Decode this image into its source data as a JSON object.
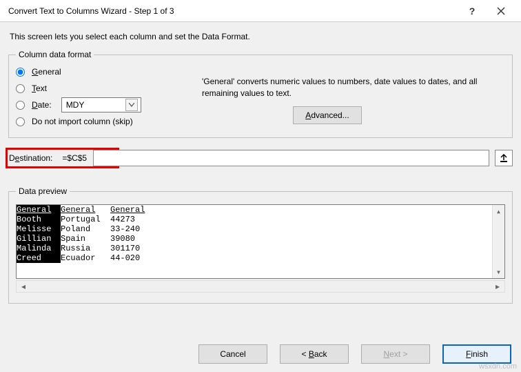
{
  "title": "Convert Text to Columns Wizard - Step 1 of 3",
  "description": "This screen lets you select each column and set the Data Format.",
  "fmt": {
    "legend": "Column data format",
    "general": "General",
    "text": "Text",
    "date": "Date:",
    "skip": "Do not import column (skip)",
    "date_option": "MDY",
    "selected": "general",
    "hint": "'General' converts numeric values to numbers, date values to dates, and all remaining values to text.",
    "advanced": "Advanced..."
  },
  "destination": {
    "label": "Destination:",
    "value": "=$C$5"
  },
  "preview": {
    "legend": "Data preview",
    "headers": [
      "General",
      "General",
      "General"
    ],
    "rows": [
      [
        "Booth",
        "Portugal",
        "44273"
      ],
      [
        "Melisse",
        "Poland",
        "33-240"
      ],
      [
        "Gillian",
        "Spain",
        "39080"
      ],
      [
        "Malinda",
        "Russia",
        "301170"
      ],
      [
        "Creed",
        "Ecuador",
        "44-020"
      ]
    ]
  },
  "buttons": {
    "cancel": "Cancel",
    "back": "< Back",
    "next": "Next >",
    "finish": "Finish"
  },
  "watermark": "wsxdn.com"
}
